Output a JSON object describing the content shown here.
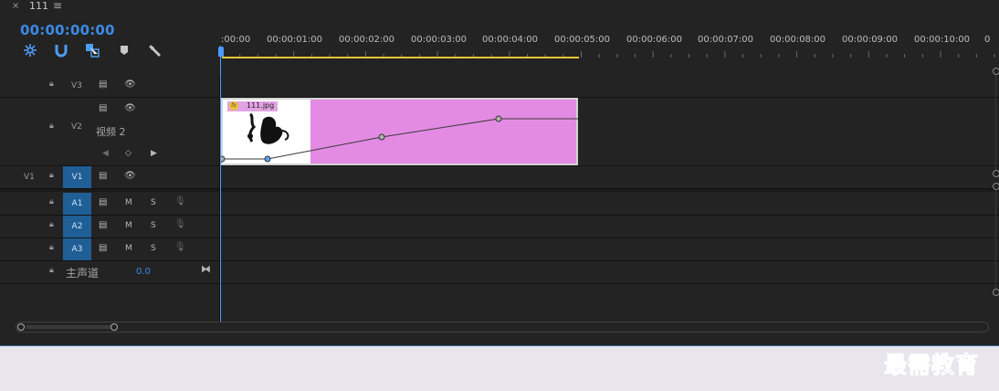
{
  "tab": {
    "close": "×",
    "title": "111",
    "menu": "≡"
  },
  "timecode": "00:00:00:00",
  "toolbar": [
    "nest-sequence-icon",
    "snap-icon",
    "linked-selection-icon",
    "add-marker-icon",
    "wrench-icon"
  ],
  "ruler": {
    "labels": [
      ":00:00",
      "00:00:01:00",
      "00:00:02:00",
      "00:00:03:00",
      "00:00:04:00",
      "00:00:05:00",
      "00:00:06:00",
      "00:00:07:00",
      "00:00:08:00",
      "00:00:09:00",
      "00:00:10:00",
      "0"
    ],
    "work_area_color": "#e6c634"
  },
  "tracks": {
    "v3": {
      "name": "V3"
    },
    "v2": {
      "name": "V2",
      "display_name": "视频 2"
    },
    "v1": {
      "source": "V1",
      "name": "V1"
    },
    "a1": {
      "name": "A1",
      "m": "M",
      "s": "S"
    },
    "a2": {
      "name": "A2",
      "m": "M",
      "s": "S"
    },
    "a3": {
      "name": "A3",
      "m": "M",
      "s": "S"
    },
    "master": {
      "name": "主声道",
      "value": "0.0"
    }
  },
  "clip": {
    "fx": "fx",
    "name": "111.jpg",
    "color": "#e38be3"
  },
  "accent_color": "#3b8ae6",
  "watermark": "最需教育"
}
